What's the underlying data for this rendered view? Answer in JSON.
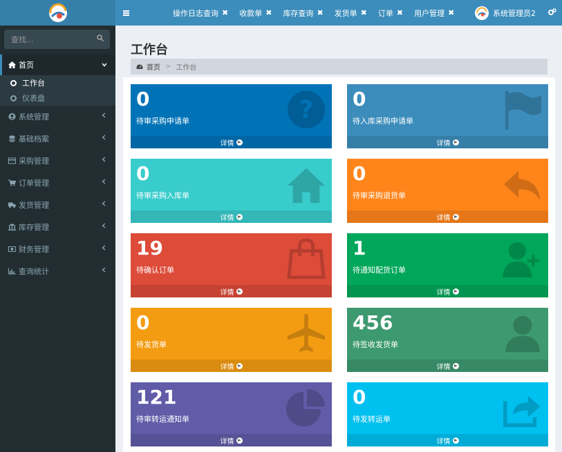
{
  "header": {
    "tabs": [
      {
        "label": "操作日志查询"
      },
      {
        "label": "收款单"
      },
      {
        "label": "库存查询"
      },
      {
        "label": "发货单"
      },
      {
        "label": "订单"
      },
      {
        "label": "用户管理"
      }
    ],
    "close_glyph": "✖",
    "user_name": "系统管理员2",
    "accent_color": "#3c8dbc"
  },
  "sidebar": {
    "search_placeholder": "查找...",
    "home": {
      "label": "首页",
      "icon": "home-icon"
    },
    "sub_items": [
      {
        "label": "工作台",
        "active": true
      },
      {
        "label": "仪表盘",
        "active": false
      }
    ],
    "items": [
      {
        "label": "系统管理",
        "icon": "user-circle-icon"
      },
      {
        "label": "基础档案",
        "icon": "database-icon"
      },
      {
        "label": "采购管理",
        "icon": "credit-card-icon"
      },
      {
        "label": "订单管理",
        "icon": "cart-icon"
      },
      {
        "label": "发货管理",
        "icon": "truck-icon"
      },
      {
        "label": "库存管理",
        "icon": "bank-icon"
      },
      {
        "label": "财务管理",
        "icon": "money-icon"
      },
      {
        "label": "查询统计",
        "icon": "bar-chart-icon"
      }
    ]
  },
  "main": {
    "title": "工作台",
    "breadcrumb": {
      "home": "首页",
      "separator": ">",
      "current": "工作台"
    },
    "boxes": [
      {
        "value": "0",
        "label": "待审采购申请单",
        "footer": "详情",
        "color": "#0073b7",
        "icon": "question-icon"
      },
      {
        "value": "0",
        "label": "待入库采购申请单",
        "footer": "详情",
        "color": "#3c8dbc",
        "icon": "flag-icon"
      },
      {
        "value": "0",
        "label": "待审采购入库单",
        "footer": "详情",
        "color": "#39cccc",
        "icon": "home-icon"
      },
      {
        "value": "0",
        "label": "待审采购退货单",
        "footer": "详情",
        "color": "#ff851b",
        "icon": "reply-icon"
      },
      {
        "value": "19",
        "label": "待确认订单",
        "footer": "详情",
        "color": "#dd4b39",
        "icon": "shopping-bag-icon"
      },
      {
        "value": "1",
        "label": "待通知配货订单",
        "footer": "详情",
        "color": "#00a65a",
        "icon": "user-plus-icon"
      },
      {
        "value": "0",
        "label": "待发货单",
        "footer": "详情",
        "color": "#f39c12",
        "icon": "plane-icon"
      },
      {
        "value": "456",
        "label": "待签收发货单",
        "footer": "详情",
        "color": "#3d9970",
        "icon": "user-icon"
      },
      {
        "value": "121",
        "label": "待审转运通知单",
        "footer": "详情",
        "color": "#605ca8",
        "icon": "pie-chart-icon"
      },
      {
        "value": "0",
        "label": "待发转运单",
        "footer": "详情",
        "color": "#00c0ef",
        "icon": "share-square-icon"
      }
    ]
  }
}
